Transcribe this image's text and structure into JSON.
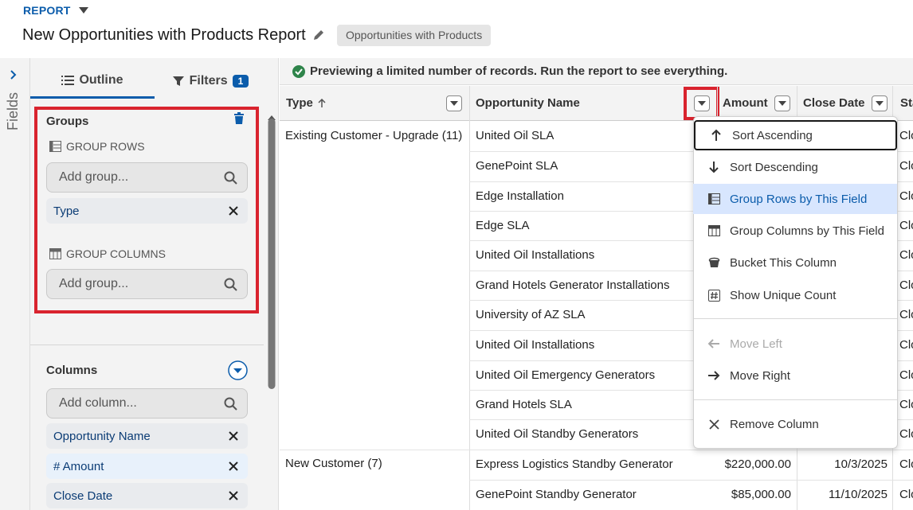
{
  "header": {
    "report_label": "REPORT",
    "title": "New Opportunities with Products Report",
    "report_type_tag": "Opportunities with Products"
  },
  "rail": {
    "label": "Fields"
  },
  "panel": {
    "tabs": [
      {
        "label": "Outline",
        "icon": "list-icon",
        "active": true
      },
      {
        "label": "Filters",
        "icon": "filter-icon",
        "badge": "1"
      }
    ],
    "groups": {
      "title": "Groups",
      "group_rows_label": "GROUP ROWS",
      "group_rows_placeholder": "Add group...",
      "group_rows_items": [
        "Type"
      ],
      "group_columns_label": "GROUP COLUMNS",
      "group_columns_placeholder": "Add group..."
    },
    "columns": {
      "title": "Columns",
      "placeholder": "Add column...",
      "items": [
        "Opportunity Name",
        "# Amount",
        "Close Date"
      ]
    }
  },
  "main": {
    "preview_message": "Previewing a limited number of records. Run the report to see everything.",
    "columns": [
      "Type",
      "Opportunity Name",
      "Amount",
      "Close Date",
      "Sta"
    ],
    "groups": [
      {
        "type": "Existing Customer - Upgrade (11)"
      },
      {
        "type": "New Customer (7)"
      }
    ],
    "rows": [
      {
        "name": "United Oil SLA",
        "amount": "",
        "close": "",
        "stage": "Clo"
      },
      {
        "name": "GenePoint SLA",
        "amount": "",
        "close": "",
        "stage": "Clo"
      },
      {
        "name": "Edge Installation",
        "amount": "",
        "close": "",
        "stage": "Clo"
      },
      {
        "name": "Edge SLA",
        "amount": "",
        "close": "",
        "stage": "Clo"
      },
      {
        "name": "United Oil Installations",
        "amount": "",
        "close": "",
        "stage": "Clo"
      },
      {
        "name": "Grand Hotels Generator Installations",
        "amount": "",
        "close": "",
        "stage": "Clo"
      },
      {
        "name": "University of AZ SLA",
        "amount": "",
        "close": "",
        "stage": "Clo"
      },
      {
        "name": "United Oil Installations",
        "amount": "",
        "close": "",
        "stage": "Clo"
      },
      {
        "name": "United Oil Emergency Generators",
        "amount": "",
        "close": "",
        "stage": "Clo"
      },
      {
        "name": "Grand Hotels SLA",
        "amount": "",
        "close": "",
        "stage": "Clo"
      },
      {
        "name": "United Oil Standby Generators",
        "amount": "",
        "close": "",
        "stage": "Clo"
      },
      {
        "name": "Express Logistics Standby Generator",
        "amount": "$220,000.00",
        "close": "10/3/2025",
        "stage": "Clo"
      },
      {
        "name": "GenePoint Standby Generator",
        "amount": "$85,000.00",
        "close": "11/10/2025",
        "stage": "Clo"
      }
    ]
  },
  "menu": {
    "items": [
      {
        "label": "Sort Ascending",
        "icon": "arrow-up-icon",
        "state": "focus"
      },
      {
        "label": "Sort Descending",
        "icon": "arrow-down-icon"
      },
      {
        "label": "Group Rows by This Field",
        "icon": "group-rows-icon",
        "state": "selected"
      },
      {
        "label": "Group Columns by This Field",
        "icon": "group-columns-icon"
      },
      {
        "label": "Bucket This Column",
        "icon": "bucket-icon"
      },
      {
        "label": "Show Unique Count",
        "icon": "hash-icon"
      },
      {
        "label": "Move Left",
        "icon": "arrow-left-icon",
        "state": "disabled"
      },
      {
        "label": "Move Right",
        "icon": "arrow-right-icon"
      },
      {
        "label": "Remove Column",
        "icon": "close-icon"
      }
    ]
  },
  "colors": {
    "brand": "#0b5cab",
    "highlight": "#d9232e",
    "success": "#2e844a"
  }
}
